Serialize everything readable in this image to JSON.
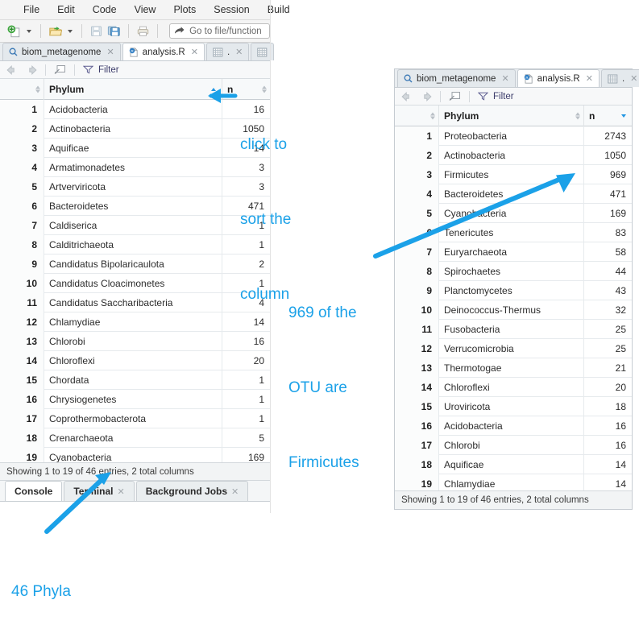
{
  "app": {
    "menubar": [
      "File",
      "Edit",
      "Code",
      "View",
      "Plots",
      "Session",
      "Build"
    ],
    "toolbar": {
      "new_file_icon": "new-file-plus-icon",
      "open_file_icon": "open-folder-icon",
      "save_icon": "save-disk-icon",
      "save_all_icon": "save-all-disk-icon",
      "print_icon": "printer-icon",
      "goto_icon": "goto-arrow-icon",
      "goto_placeholder": "Go to file/function"
    }
  },
  "left_panel": {
    "tabs": [
      {
        "label": "biom_metagenome",
        "icon": "search-magnifier-icon",
        "active": false,
        "closable": true
      },
      {
        "label": "analysis.R",
        "icon": "r-script-icon",
        "active": true,
        "closable": true
      },
      {
        "label": ".",
        "icon": "data-grid-icon",
        "active": false,
        "closable": true
      },
      {
        "label": "",
        "icon": "data-grid-icon",
        "active": false,
        "closable": false
      }
    ],
    "filterbar": {
      "back_icon": "arrow-left-icon",
      "forward_icon": "arrow-right-icon",
      "popout_icon": "show-in-new-window-icon",
      "filter_icon": "funnel-icon",
      "filter_label": "Filter"
    },
    "table": {
      "columns": [
        "",
        "Phylum",
        "n"
      ],
      "sort": {
        "column": "Phylum",
        "direction": "asc"
      },
      "rows": [
        {
          "num": "1",
          "phylum": "Acidobacteria",
          "n": "16"
        },
        {
          "num": "2",
          "phylum": "Actinobacteria",
          "n": "1050"
        },
        {
          "num": "3",
          "phylum": "Aquificae",
          "n": "14"
        },
        {
          "num": "4",
          "phylum": "Armatimonadetes",
          "n": "3"
        },
        {
          "num": "5",
          "phylum": "Artverviricota",
          "n": "3"
        },
        {
          "num": "6",
          "phylum": "Bacteroidetes",
          "n": "471"
        },
        {
          "num": "7",
          "phylum": "Caldiserica",
          "n": "1"
        },
        {
          "num": "8",
          "phylum": "Calditrichaeota",
          "n": "1"
        },
        {
          "num": "9",
          "phylum": "Candidatus Bipolaricaulota",
          "n": "2"
        },
        {
          "num": "10",
          "phylum": "Candidatus Cloacimonetes",
          "n": "1"
        },
        {
          "num": "11",
          "phylum": "Candidatus Saccharibacteria",
          "n": "4"
        },
        {
          "num": "12",
          "phylum": "Chlamydiae",
          "n": "14"
        },
        {
          "num": "13",
          "phylum": "Chlorobi",
          "n": "16"
        },
        {
          "num": "14",
          "phylum": "Chloroflexi",
          "n": "20"
        },
        {
          "num": "15",
          "phylum": "Chordata",
          "n": "1"
        },
        {
          "num": "16",
          "phylum": "Chrysiogenetes",
          "n": "1"
        },
        {
          "num": "17",
          "phylum": "Coprothermobacterota",
          "n": "1"
        },
        {
          "num": "18",
          "phylum": "Crenarchaeota",
          "n": "5"
        },
        {
          "num": "19",
          "phylum": "Cyanobacteria",
          "n": "169"
        }
      ]
    },
    "status": "Showing 1 to 19 of 46 entries, 2 total columns",
    "bottom_tabs": [
      {
        "label": "Console",
        "active": true,
        "closable": false
      },
      {
        "label": "Terminal",
        "active": false,
        "closable": true
      },
      {
        "label": "Background Jobs",
        "active": false,
        "closable": true
      }
    ]
  },
  "right_panel": {
    "tabs": [
      {
        "label": "biom_metagenome",
        "icon": "search-magnifier-icon",
        "active": false,
        "closable": true
      },
      {
        "label": "analysis.R",
        "icon": "r-script-icon",
        "active": true,
        "closable": true
      },
      {
        "label": ".",
        "icon": "data-grid-icon",
        "active": false,
        "closable": true
      }
    ],
    "filterbar": {
      "back_icon": "arrow-left-icon",
      "forward_icon": "arrow-right-icon",
      "popout_icon": "show-in-new-window-icon",
      "filter_icon": "funnel-icon",
      "filter_label": "Filter"
    },
    "table": {
      "columns": [
        "",
        "Phylum",
        "n"
      ],
      "sort": {
        "column": "n",
        "direction": "desc"
      },
      "rows": [
        {
          "num": "1",
          "phylum": "Proteobacteria",
          "n": "2743"
        },
        {
          "num": "2",
          "phylum": "Actinobacteria",
          "n": "1050"
        },
        {
          "num": "3",
          "phylum": "Firmicutes",
          "n": "969"
        },
        {
          "num": "4",
          "phylum": "Bacteroidetes",
          "n": "471"
        },
        {
          "num": "5",
          "phylum": "Cyanobacteria",
          "n": "169"
        },
        {
          "num": "6",
          "phylum": "Tenericutes",
          "n": "83"
        },
        {
          "num": "7",
          "phylum": "Euryarchaeota",
          "n": "58"
        },
        {
          "num": "8",
          "phylum": "Spirochaetes",
          "n": "44"
        },
        {
          "num": "9",
          "phylum": "Planctomycetes",
          "n": "43"
        },
        {
          "num": "10",
          "phylum": "Deinococcus-Thermus",
          "n": "32"
        },
        {
          "num": "11",
          "phylum": "Fusobacteria",
          "n": "25"
        },
        {
          "num": "12",
          "phylum": "Verrucomicrobia",
          "n": "25"
        },
        {
          "num": "13",
          "phylum": "Thermotogae",
          "n": "21"
        },
        {
          "num": "14",
          "phylum": "Chloroflexi",
          "n": "20"
        },
        {
          "num": "15",
          "phylum": "Uroviricota",
          "n": "18"
        },
        {
          "num": "16",
          "phylum": "Acidobacteria",
          "n": "16"
        },
        {
          "num": "17",
          "phylum": "Chlorobi",
          "n": "16"
        },
        {
          "num": "18",
          "phylum": "Aquificae",
          "n": "14"
        },
        {
          "num": "19",
          "phylum": "Chlamydiae",
          "n": "14"
        }
      ]
    },
    "status": "Showing 1 to 19 of 46 entries, 2 total columns"
  },
  "annotations": {
    "color": "#1ba1e8",
    "sort_note": {
      "lines": [
        "click to",
        "sort the",
        "column"
      ]
    },
    "firmicutes_note": {
      "lines": [
        "969 of the",
        "OTU are",
        "Firmicutes"
      ]
    },
    "phyla_note": {
      "lines": [
        "46 Phyla"
      ]
    }
  }
}
